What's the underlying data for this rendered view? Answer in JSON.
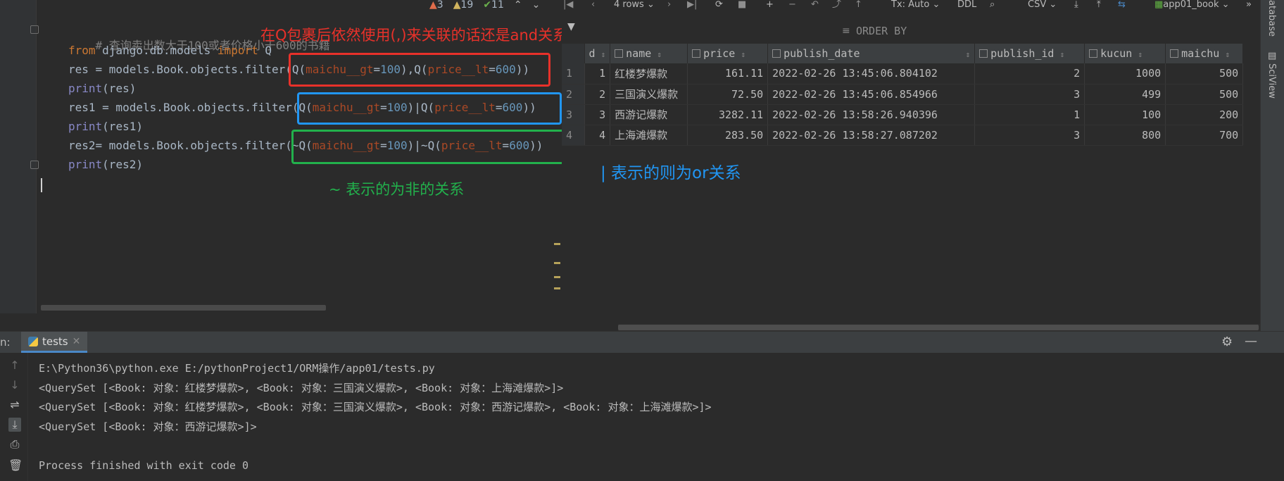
{
  "editor": {
    "inspections": {
      "errors": "3",
      "warnings": "19",
      "weak": "11"
    },
    "lines": [
      {
        "comment": "# 查询卖出数大于100或者价格小于600的书籍"
      },
      {
        "kw1": "from",
        "t1": " django.db.models ",
        "kw2": "import",
        "t2": " Q"
      },
      {
        "t1": "res = models.Book.objects.filter(",
        "f1": "Q(",
        "k1": "maichu__gt",
        "e1": "=",
        "n1": "100",
        "c1": "),",
        "f2": "Q(",
        "k2": "price__lt",
        "e2": "=",
        "n2": "600",
        "c2": "))"
      },
      {
        "fn": "print",
        "t1": "(res)"
      },
      {
        "t1": "res1 = models.Book.objects.filter(",
        "f1": "Q(",
        "k1": "maichu__gt",
        "e1": "=",
        "n1": "100",
        "c1": ")|",
        "f2": "Q(",
        "k2": "price__lt",
        "e2": "=",
        "n2": "600",
        "c2": "))"
      },
      {
        "fn": "print",
        "t1": "(res1)"
      },
      {
        "t1": "res2= models.Book.objects.filter(",
        "f1": "~Q(",
        "k1": "maichu__gt",
        "e1": "=",
        "n1": "100",
        "c1": ")|",
        "f2": "~Q(",
        "k2": "price__lt",
        "e2": "=",
        "n2": "600",
        "c2": "))"
      },
      {
        "fn": "print",
        "t1": "(res2)"
      }
    ]
  },
  "annotations": {
    "and_note": "在Q包裹后依然使用(,)来关联的话还是and关系",
    "or_note": "| 表示的则为or关系",
    "not_note": "~ 表示的为非的关系",
    "colors": {
      "red": "#e8312a",
      "blue": "#2196f3",
      "green": "#22b14c"
    }
  },
  "db": {
    "toolbar": {
      "rows": "4 rows",
      "tx": "Tx: Auto",
      "ddl": "DDL",
      "csv": "CSV",
      "table": "app01_book"
    },
    "order_by": "ORDER BY",
    "columns": [
      "d",
      "name",
      "price",
      "publish_date",
      "publish_id",
      "kucun",
      "maichu"
    ],
    "rows": [
      {
        "rn": "1",
        "id": "1",
        "name": "红楼梦爆款",
        "price": "161.11",
        "publish_date": "2022-02-26 13:45:06.804102",
        "publish_id": "2",
        "kucun": "1000",
        "maichu": "500"
      },
      {
        "rn": "2",
        "id": "2",
        "name": "三国演义爆款",
        "price": "72.50",
        "publish_date": "2022-02-26 13:45:06.854966",
        "publish_id": "3",
        "kucun": "499",
        "maichu": "500"
      },
      {
        "rn": "3",
        "id": "3",
        "name": "西游记爆款",
        "price": "3282.11",
        "publish_date": "2022-02-26 13:58:26.940396",
        "publish_id": "1",
        "kucun": "100",
        "maichu": "200"
      },
      {
        "rn": "4",
        "id": "4",
        "name": "上海滩爆款",
        "price": "283.50",
        "publish_date": "2022-02-26 13:58:27.087202",
        "publish_id": "3",
        "kucun": "800",
        "maichu": "700"
      }
    ]
  },
  "side": {
    "database": "atabase",
    "sciview": "SciView"
  },
  "run": {
    "edge_label": "n:",
    "tab_label": "tests",
    "output": [
      "E:\\Python36\\python.exe E:/pythonProject1/ORM操作/app01/tests.py",
      "<QuerySet [<Book: 对象：红楼梦爆款>, <Book: 对象：三国演义爆款>, <Book: 对象：上海滩爆款>]>",
      "<QuerySet [<Book: 对象：红楼梦爆款>, <Book: 对象：三国演义爆款>, <Book: 对象：西游记爆款>, <Book: 对象：上海滩爆款>]>",
      "<QuerySet [<Book: 对象：西游记爆款>]>",
      "",
      "Process finished with exit code 0"
    ]
  }
}
